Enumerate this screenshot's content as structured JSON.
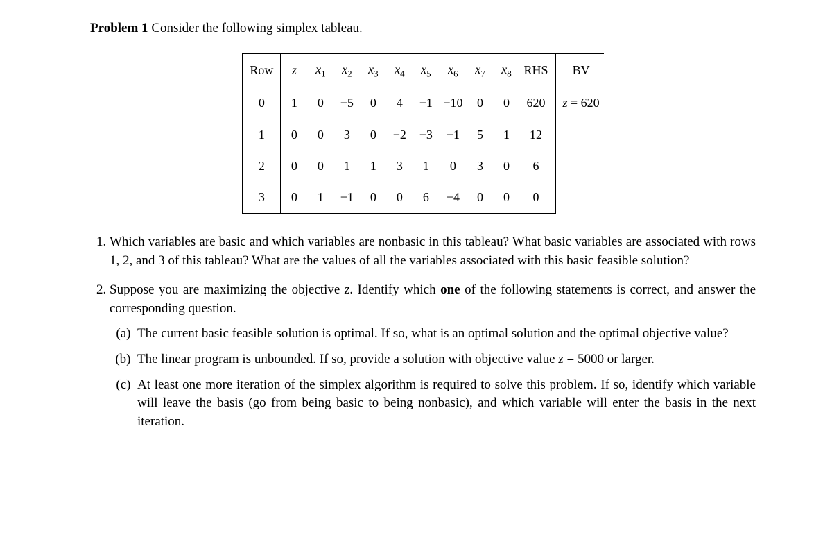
{
  "title_bold": "Problem 1",
  "title_rest": " Consider the following simplex tableau.",
  "headers": {
    "row": "Row",
    "z": "z",
    "x1": "x",
    "s1": "1",
    "x2": "x",
    "s2": "2",
    "x3": "x",
    "s3": "3",
    "x4": "x",
    "s4": "4",
    "x5": "x",
    "s5": "5",
    "x6": "x",
    "s6": "6",
    "x7": "x",
    "s7": "7",
    "x8": "x",
    "s8": "8",
    "rhs": "RHS",
    "bv": "BV"
  },
  "rows": [
    {
      "r": "0",
      "z": "1",
      "x1": "0",
      "x2": "−5",
      "x3": "0",
      "x4": "4",
      "x5": "−1",
      "x6": "−10",
      "x7": "0",
      "x8": "0",
      "rhs": "620",
      "bv": "z = 620"
    },
    {
      "r": "1",
      "z": "0",
      "x1": "0",
      "x2": "3",
      "x3": "0",
      "x4": "−2",
      "x5": "−3",
      "x6": "−1",
      "x7": "5",
      "x8": "1",
      "rhs": "12",
      "bv": ""
    },
    {
      "r": "2",
      "z": "0",
      "x1": "0",
      "x2": "1",
      "x3": "1",
      "x4": "3",
      "x5": "1",
      "x6": "0",
      "x7": "3",
      "x8": "0",
      "rhs": "6",
      "bv": ""
    },
    {
      "r": "3",
      "z": "0",
      "x1": "1",
      "x2": "−1",
      "x3": "0",
      "x4": "0",
      "x5": "6",
      "x6": "−4",
      "x7": "0",
      "x8": "0",
      "rhs": "0",
      "bv": ""
    }
  ],
  "q1": "Which variables are basic and which variables are nonbasic in this tableau?  What basic variables are associated with rows 1, 2, and 3 of this tableau? What are the values of all the variables associated with this basic feasible solution?",
  "q2_intro_a": "Suppose you are maximizing the objective ",
  "q2_intro_z": "z",
  "q2_intro_b": ". Identify which ",
  "q2_intro_one": "one",
  "q2_intro_c": " of the following statements is correct, and answer the corresponding question.",
  "q2a": "The current basic feasible solution is optimal. If so, what is an optimal solution and the optimal objective value?",
  "q2b_a": "The linear program is unbounded. If so, provide a solution with objective value ",
  "q2b_z": "z",
  "q2b_b": " = 5000 or larger.",
  "q2c": "At least one more iteration of the simplex algorithm is required to solve this problem. If so, identify which variable will leave the basis (go from being basic to being nonbasic), and which variable will enter the basis in the next iteration."
}
